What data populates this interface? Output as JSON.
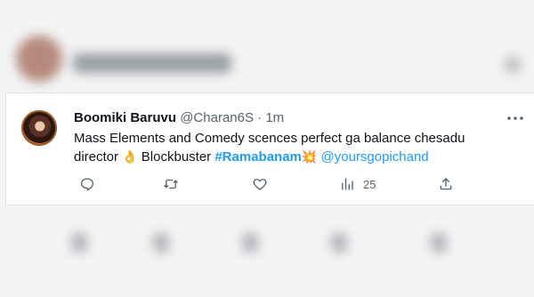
{
  "tweet": {
    "author_name": "Boomiki Baruvu",
    "handle": "@Charan6S",
    "separator": "·",
    "time": "1m",
    "text": {
      "line1": "Mass Elements and Comedy scences perfect ga balance chesadu",
      "line2_start": "director ",
      "emoji1": "👌",
      "line2_mid": " Blockbuster ",
      "hashtag": "#Ramabanam",
      "emoji2": "💥",
      "mention": " @yoursgopichand"
    },
    "actions": {
      "reply_icon": "comment-bubble-icon",
      "retweet_icon": "retweet-icon",
      "like_icon": "heart-icon",
      "views_icon": "analytics-bar-icon",
      "views_count": "25",
      "share_icon": "share-upload-icon"
    }
  },
  "colors": {
    "link_blue": "#1d9bf0",
    "text_primary": "#0f1419",
    "text_secondary": "#536471"
  }
}
